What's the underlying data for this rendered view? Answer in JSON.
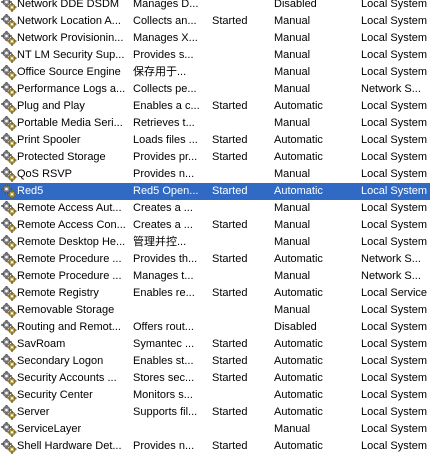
{
  "services": [
    {
      "name": "Network DDE DSDM",
      "description": "Manages D...",
      "status": "",
      "startup": "Disabled",
      "logon": "Local System"
    },
    {
      "name": "Network Location A...",
      "description": "Collects an...",
      "status": "Started",
      "startup": "Manual",
      "logon": "Local System"
    },
    {
      "name": "Network Provisionin...",
      "description": "Manages X...",
      "status": "",
      "startup": "Manual",
      "logon": "Local System"
    },
    {
      "name": "NT LM Security Sup...",
      "description": "Provides s...",
      "status": "",
      "startup": "Manual",
      "logon": "Local System"
    },
    {
      "name": "Office Source Engine",
      "description": "保存用于...",
      "status": "",
      "startup": "Manual",
      "logon": "Local System"
    },
    {
      "name": "Performance Logs a...",
      "description": "Collects pe...",
      "status": "",
      "startup": "Manual",
      "logon": "Network S..."
    },
    {
      "name": "Plug and Play",
      "description": "Enables a c...",
      "status": "Started",
      "startup": "Automatic",
      "logon": "Local System"
    },
    {
      "name": "Portable Media Seri...",
      "description": "Retrieves t...",
      "status": "",
      "startup": "Manual",
      "logon": "Local System"
    },
    {
      "name": "Print Spooler",
      "description": "Loads files ...",
      "status": "Started",
      "startup": "Automatic",
      "logon": "Local System"
    },
    {
      "name": "Protected Storage",
      "description": "Provides pr...",
      "status": "Started",
      "startup": "Automatic",
      "logon": "Local System"
    },
    {
      "name": "QoS RSVP",
      "description": "Provides n...",
      "status": "",
      "startup": "Manual",
      "logon": "Local System"
    },
    {
      "name": "Red5",
      "description": "Red5 Open...",
      "status": "Started",
      "startup": "Automatic",
      "logon": "Local System",
      "selected": true
    },
    {
      "name": "Remote Access Aut...",
      "description": "Creates a ...",
      "status": "",
      "startup": "Manual",
      "logon": "Local System"
    },
    {
      "name": "Remote Access Con...",
      "description": "Creates a ...",
      "status": "Started",
      "startup": "Manual",
      "logon": "Local System"
    },
    {
      "name": "Remote Desktop He...",
      "description": "管理并控...",
      "status": "",
      "startup": "Manual",
      "logon": "Local System"
    },
    {
      "name": "Remote Procedure ...",
      "description": "Provides th...",
      "status": "Started",
      "startup": "Automatic",
      "logon": "Network S..."
    },
    {
      "name": "Remote Procedure ...",
      "description": "Manages t...",
      "status": "",
      "startup": "Manual",
      "logon": "Network S..."
    },
    {
      "name": "Remote Registry",
      "description": "Enables re...",
      "status": "Started",
      "startup": "Automatic",
      "logon": "Local Service"
    },
    {
      "name": "Removable Storage",
      "description": "",
      "status": "",
      "startup": "Manual",
      "logon": "Local System"
    },
    {
      "name": "Routing and Remot...",
      "description": "Offers rout...",
      "status": "",
      "startup": "Disabled",
      "logon": "Local System"
    },
    {
      "name": "SavRoam",
      "description": "Symantec ...",
      "status": "Started",
      "startup": "Automatic",
      "logon": "Local System"
    },
    {
      "name": "Secondary Logon",
      "description": "Enables st...",
      "status": "Started",
      "startup": "Automatic",
      "logon": "Local System"
    },
    {
      "name": "Security Accounts ...",
      "description": "Stores sec...",
      "status": "Started",
      "startup": "Automatic",
      "logon": "Local System"
    },
    {
      "name": "Security Center",
      "description": "Monitors s...",
      "status": "",
      "startup": "Automatic",
      "logon": "Local System"
    },
    {
      "name": "Server",
      "description": "Supports fil...",
      "status": "Started",
      "startup": "Automatic",
      "logon": "Local System"
    },
    {
      "name": "ServiceLayer",
      "description": "",
      "status": "",
      "startup": "Manual",
      "logon": "Local System"
    },
    {
      "name": "Shell Hardware Det...",
      "description": "Provides n...",
      "status": "Started",
      "startup": "Automatic",
      "logon": "Local System"
    }
  ],
  "colors": {
    "selection": "#316ac5",
    "selection_text": "#ffffff"
  },
  "icon": "service-gears-icon"
}
